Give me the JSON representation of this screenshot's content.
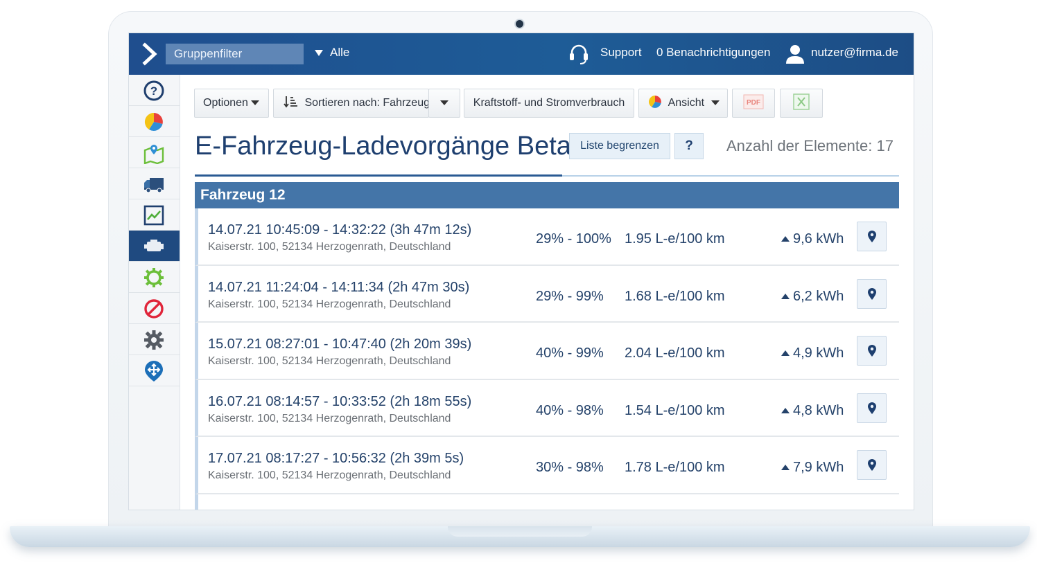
{
  "topbar": {
    "group_filter": "Gruppenfilter",
    "group_value": "Alle",
    "support": "Support",
    "notifications": "0 Benachrichtigungen",
    "user": "nutzer@firma.de"
  },
  "sidebar": {
    "items": [
      {
        "icon": "help-icon"
      },
      {
        "icon": "pie-chart-icon"
      },
      {
        "icon": "map-icon"
      },
      {
        "icon": "truck-icon"
      },
      {
        "icon": "trend-chart-icon"
      },
      {
        "icon": "engine-icon",
        "active": true
      },
      {
        "icon": "gear-outline-icon"
      },
      {
        "icon": "prohibited-icon"
      },
      {
        "icon": "settings-gear-icon"
      },
      {
        "icon": "location-move-icon"
      }
    ]
  },
  "toolbar": {
    "options": "Optionen",
    "sort": "Sortieren nach: Fahrzeug",
    "fuel": "Kraftstoff- und Stromverbrauch",
    "view": "Ansicht",
    "pdf": "PDF"
  },
  "page": {
    "title": "E-Fahrzeug-Ladevorgänge Beta",
    "limit_button": "Liste begrenzen",
    "help_button": "?",
    "count": "Anzahl der Elemente: 17"
  },
  "group": {
    "name": "Fahrzeug 12",
    "rows": [
      {
        "time": "14.07.21 10:45:09 - 14:32:22 (3h 47m 12s)",
        "address": "Kaiserstr. 100, 52134 Herzogenrath, Deutschland",
        "soc": "29% - 100%",
        "consumption": "1.95 L-e/100 km",
        "energy": "9,6 kWh"
      },
      {
        "time": "14.07.21 11:24:04 - 14:11:34 (2h 47m 30s)",
        "address": "Kaiserstr. 100, 52134 Herzogenrath, Deutschland",
        "soc": "29% - 99%",
        "consumption": "1.68 L-e/100 km",
        "energy": "6,2 kWh"
      },
      {
        "time": "15.07.21 08:27:01 - 10:47:40 (2h 20m 39s)",
        "address": "Kaiserstr. 100, 52134 Herzogenrath, Deutschland",
        "soc": "40% - 99%",
        "consumption": "2.04 L-e/100 km",
        "energy": "4,9 kWh"
      },
      {
        "time": "16.07.21 08:14:57 - 10:33:52 (2h 18m 55s)",
        "address": "Kaiserstr. 100, 52134 Herzogenrath, Deutschland",
        "soc": "40% - 98%",
        "consumption": "1.54 L-e/100 km",
        "energy": "4,8 kWh"
      },
      {
        "time": "17.07.21 08:17:27 - 10:56:32 (2h 39m 5s)",
        "address": "Kaiserstr. 100, 52134 Herzogenrath, Deutschland",
        "soc": "30% - 98%",
        "consumption": "1.78 L-e/100 km",
        "energy": "7,9 kWh"
      }
    ]
  },
  "colors": {
    "topbar": "#1f4e8e",
    "accent": "#4475a8",
    "text_primary": "#24426a"
  }
}
